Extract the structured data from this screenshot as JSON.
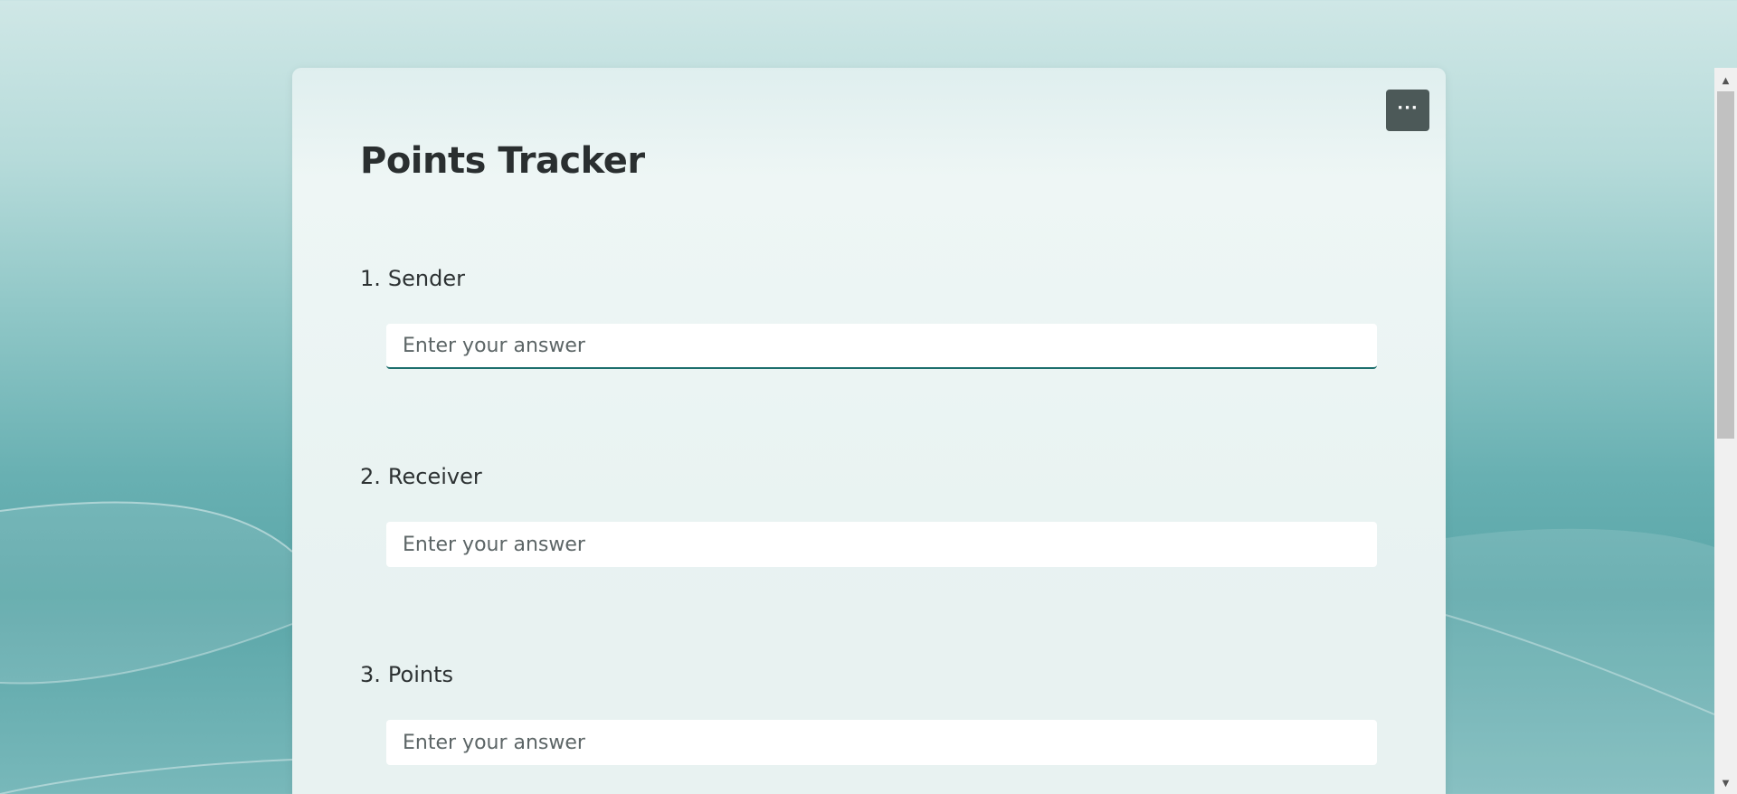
{
  "form": {
    "title": "Points Tracker",
    "more_options_label": "···"
  },
  "questions": [
    {
      "number": "1.",
      "label": "Sender",
      "placeholder": "Enter your answer",
      "focused": true
    },
    {
      "number": "2.",
      "label": "Receiver",
      "placeholder": "Enter your answer",
      "focused": false
    },
    {
      "number": "3.",
      "label": "Points",
      "placeholder": "Enter your answer",
      "focused": false
    }
  ],
  "theme": {
    "accent": "#1d6f6d",
    "more_button_bg": "#4c5958",
    "background_top": "#cfe7e6",
    "background_bottom": "#5aa6a8"
  },
  "scrollbar": {
    "up_arrow": "▲",
    "down_arrow": "▼"
  }
}
